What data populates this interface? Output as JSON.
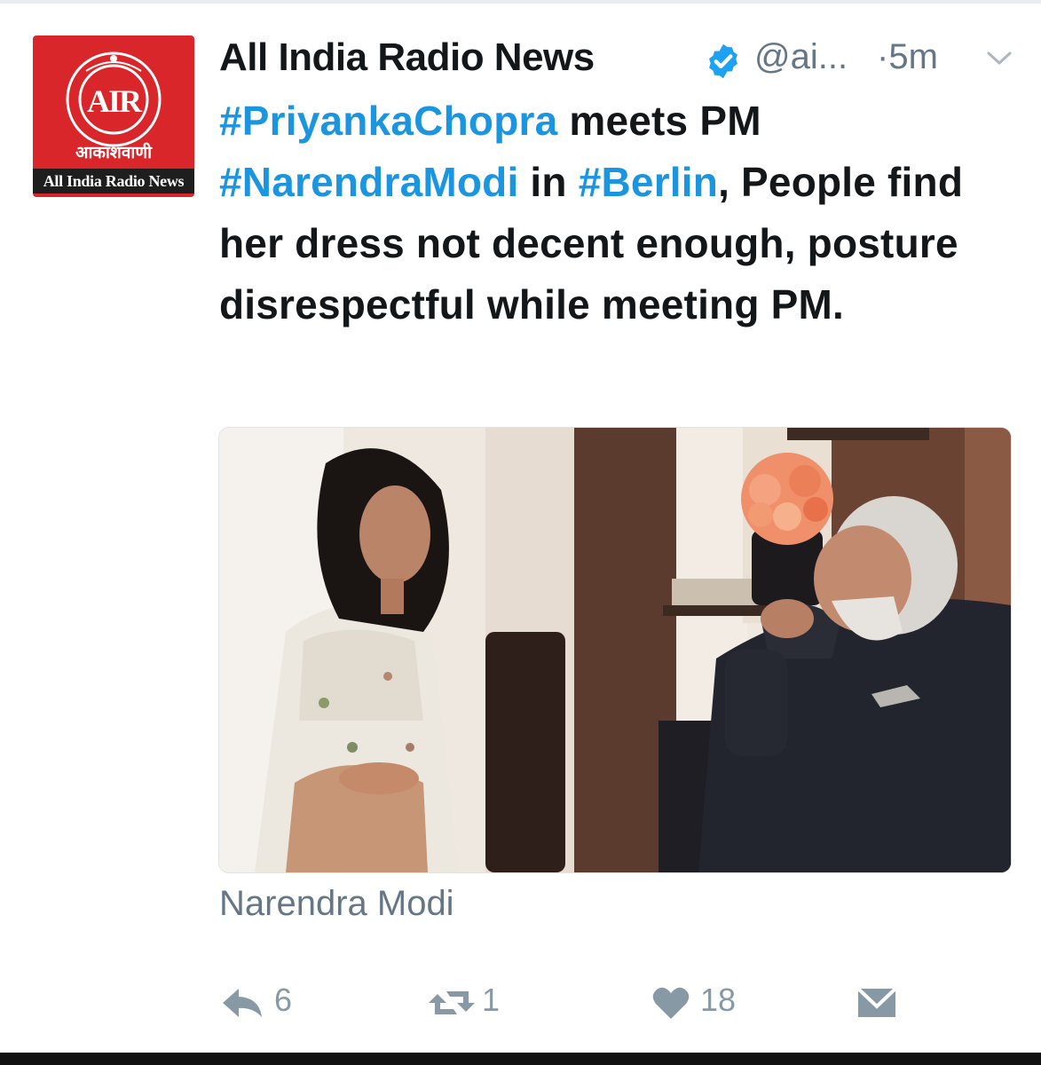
{
  "account": {
    "display_name": "All India Radio News",
    "handle": "@ai...",
    "separator_time": "·5m",
    "verified": true
  },
  "avatar": {
    "logo_hindi": "आकाशवाणी",
    "logo_caption": "All India Radio News",
    "logo_initials": "AIR",
    "bg_color": "#d9262a"
  },
  "tweet": {
    "seg1": "#PriyankaChopra",
    "seg2": " meets PM ",
    "seg3": "#NarendraModi",
    "seg4": " in ",
    "seg5": "#Berlin",
    "seg6": ", People find her dress not decent enough, posture disrespectful while meeting PM.",
    "hashtag_color": "#1b95e0"
  },
  "photo": {
    "tagged_person": "Narendra Modi"
  },
  "actions": {
    "reply_count": "6",
    "retweet_count": "1",
    "like_count": "18",
    "icon_color": "#8899a6"
  },
  "icons": [
    "verified-badge-icon",
    "chevron-down-icon",
    "reply-icon",
    "retweet-icon",
    "heart-icon",
    "direct-message-icon"
  ]
}
